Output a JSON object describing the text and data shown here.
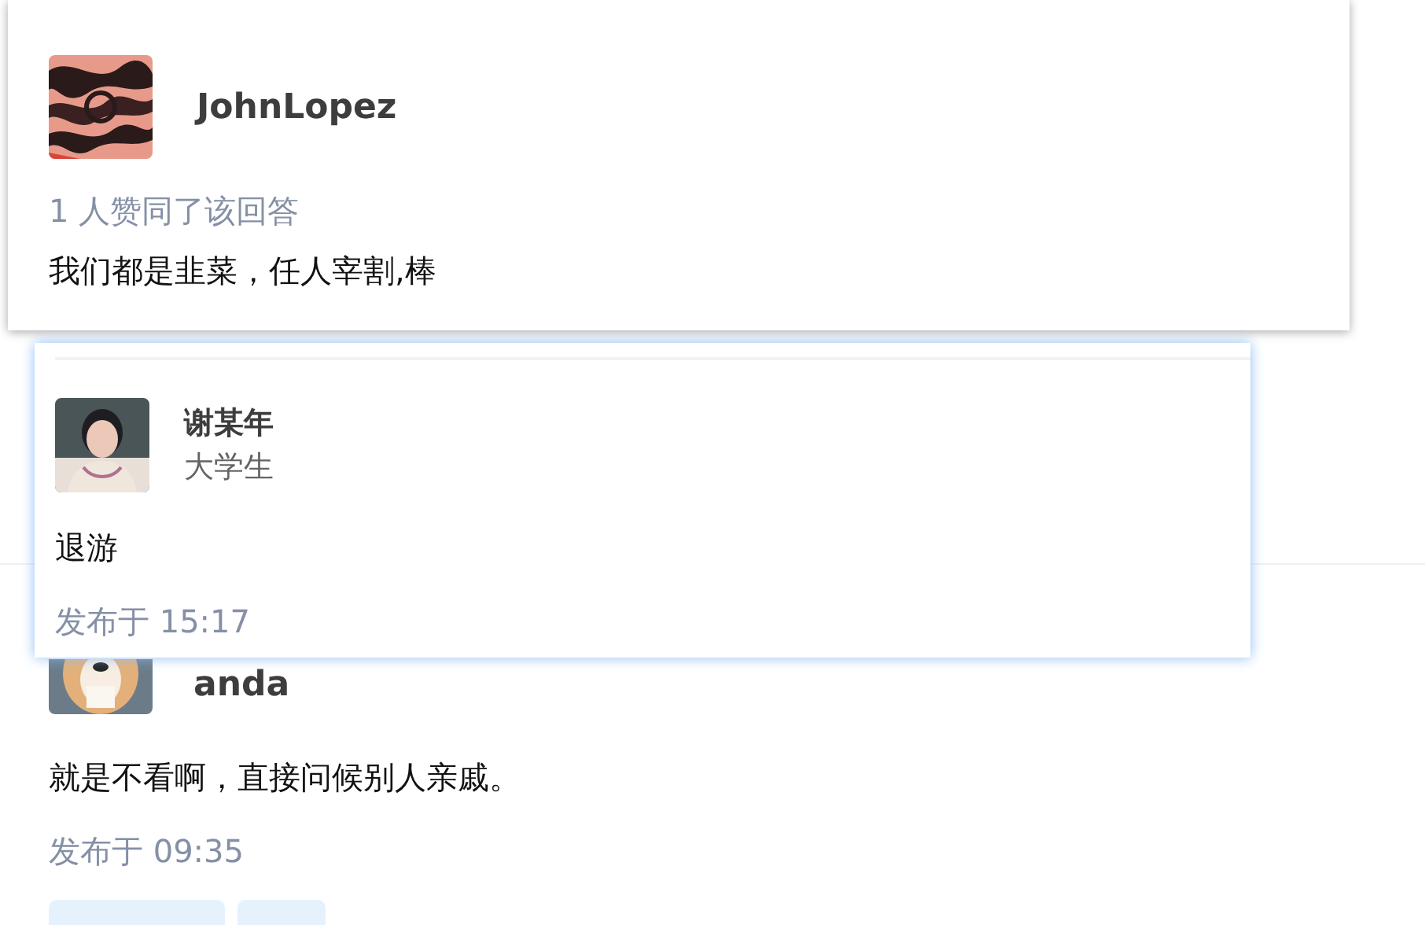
{
  "answer_card": {
    "author": "JohnLopez",
    "votes": "1 人赞同了该回答",
    "content": "我们都是韭菜，任人宰割,棒"
  },
  "comment_card": {
    "author": "谢某年",
    "headline": "大学生",
    "content": "退游",
    "time": "发布于 15:17"
  },
  "answer": {
    "author": "anda",
    "content": "就是不看啊，直接问候别人亲戚。",
    "time": "发布于 09:35",
    "actions": [
      {
        "kind": "button"
      },
      {
        "kind": "button"
      }
    ]
  }
}
